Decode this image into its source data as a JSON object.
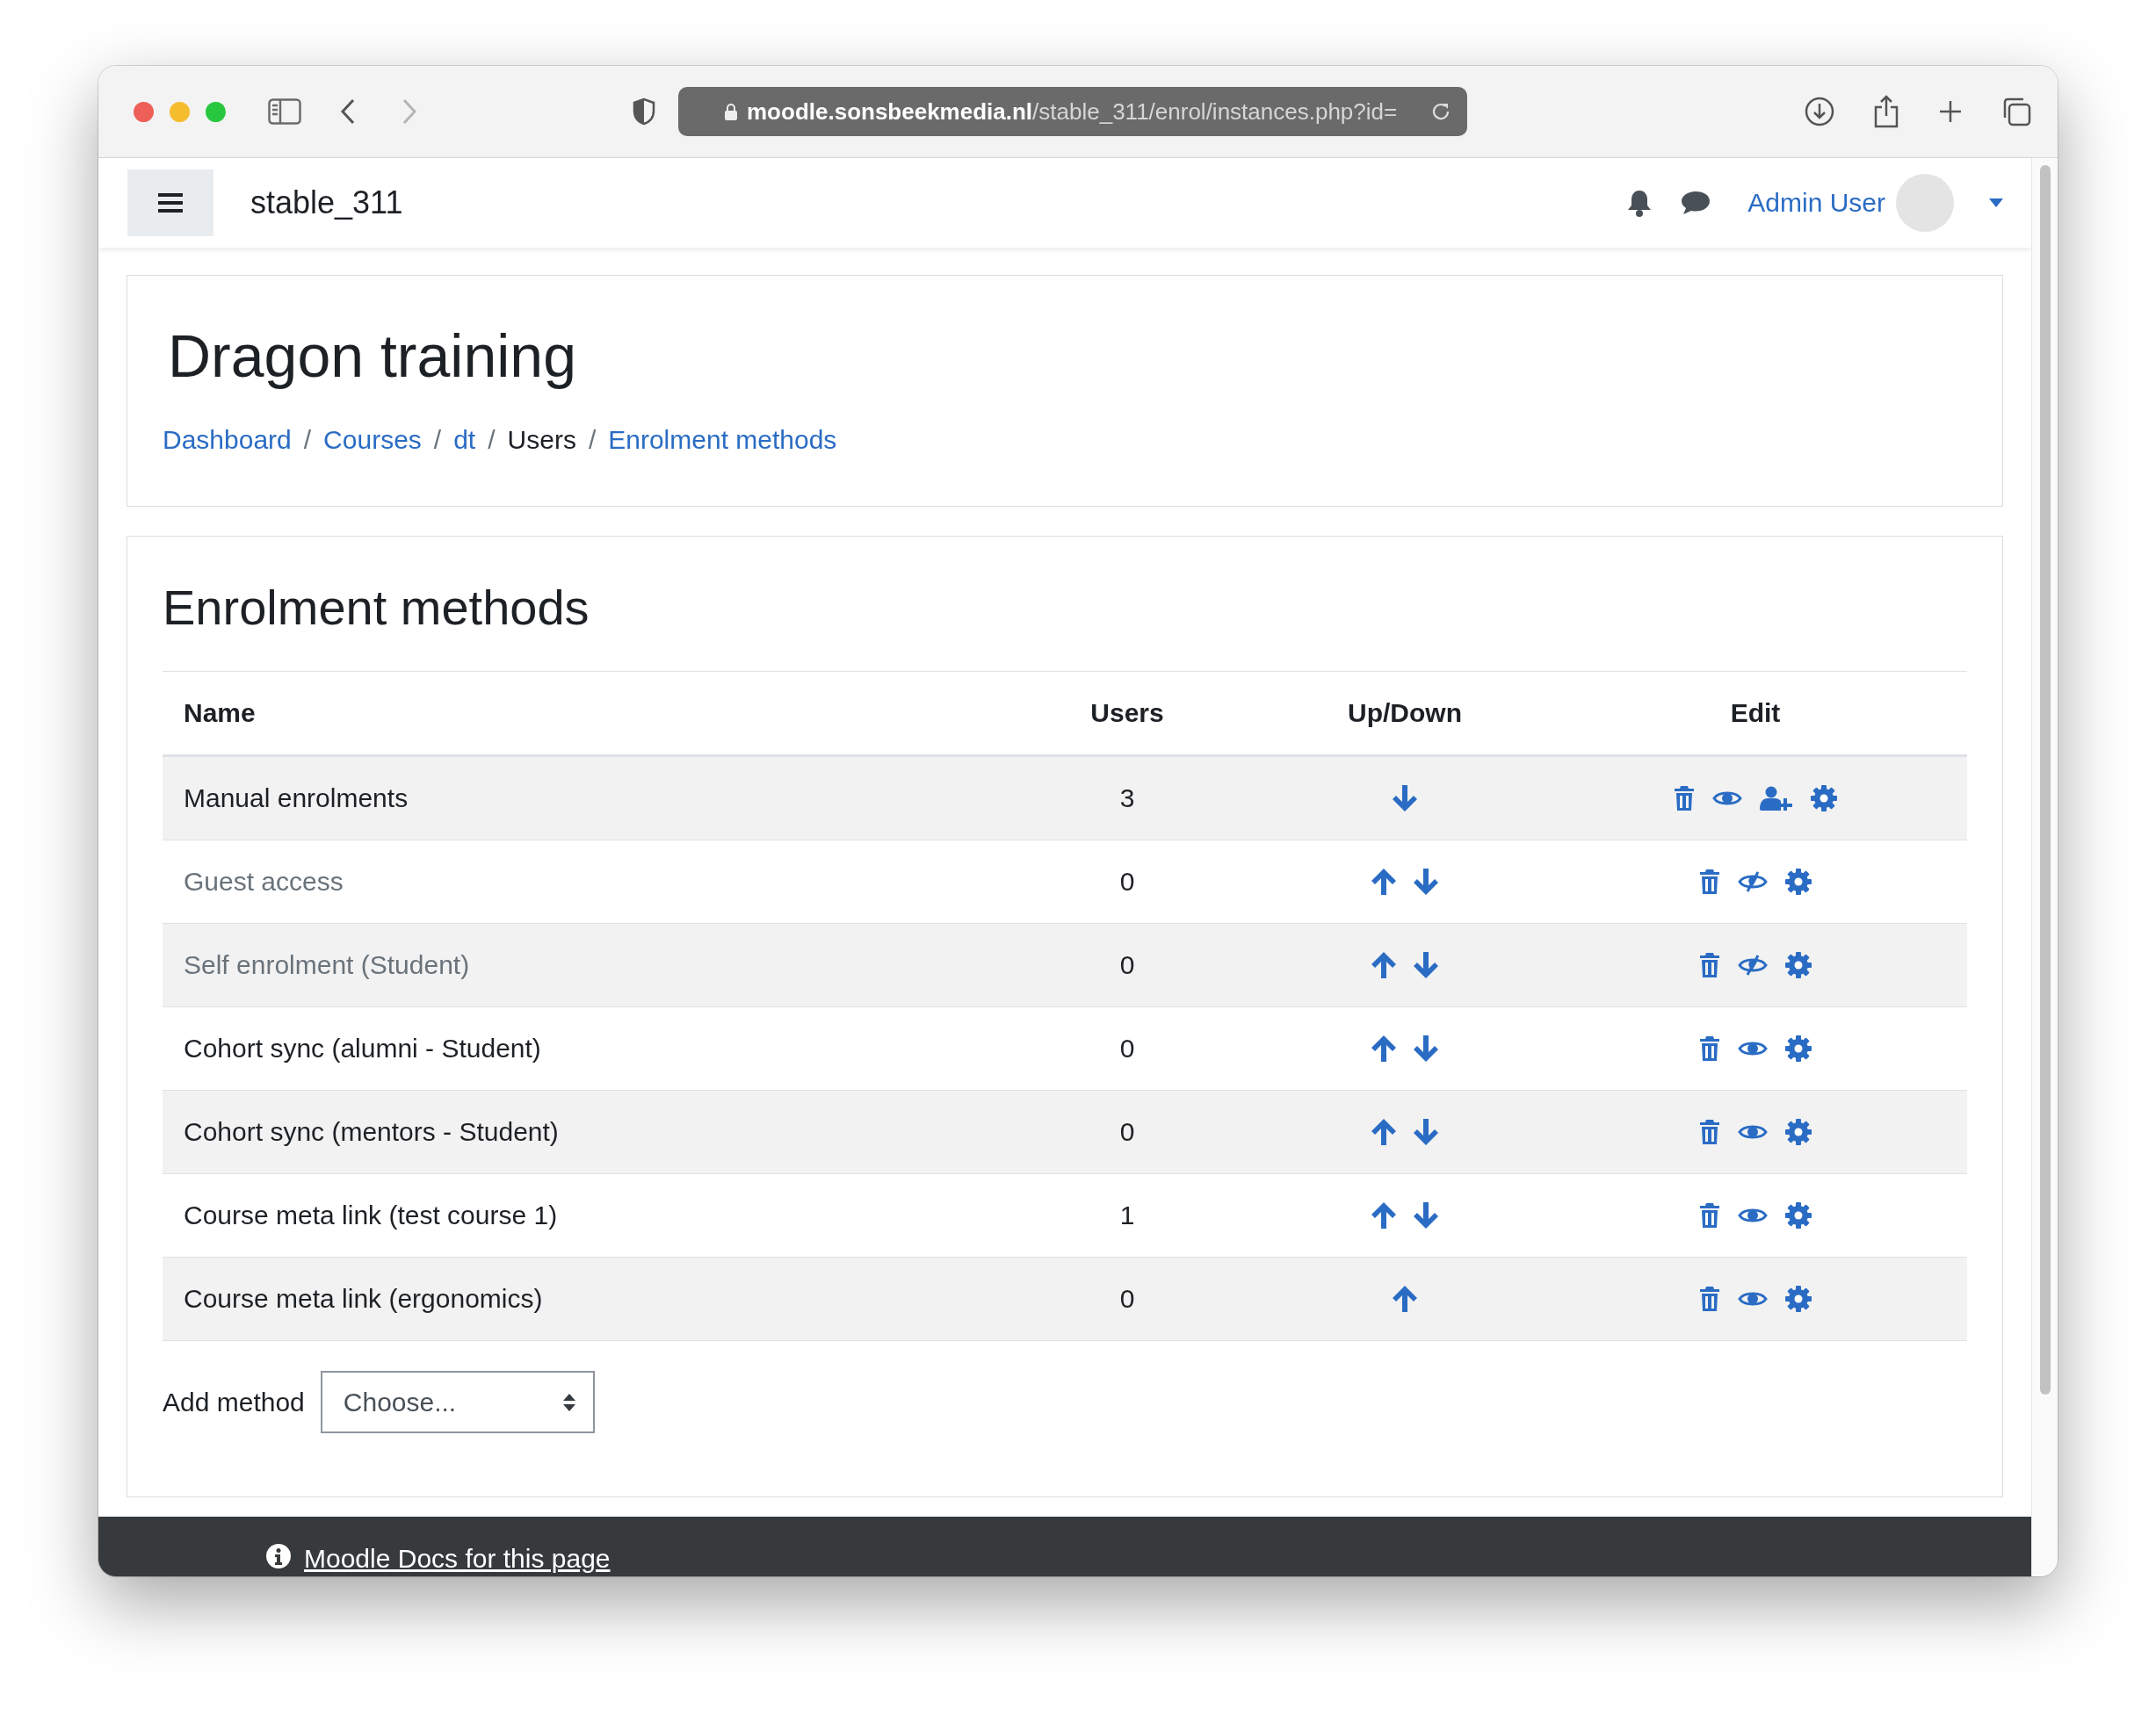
{
  "browser": {
    "url_host": "moodle.sonsbeekmedia.nl",
    "url_path": "/stable_311/enrol/instances.php?id="
  },
  "navbar": {
    "site_name": "stable_311",
    "user_name": "Admin User"
  },
  "page_header": {
    "title": "Dragon training",
    "separator": "/",
    "breadcrumbs": [
      {
        "label": "Dashboard",
        "link": true
      },
      {
        "label": "Courses",
        "link": true
      },
      {
        "label": "dt",
        "link": true
      },
      {
        "label": "Users",
        "link": false
      },
      {
        "label": "Enrolment methods",
        "link": true
      }
    ]
  },
  "section": {
    "heading": "Enrolment methods",
    "table": {
      "columns": [
        "Name",
        "Users",
        "Up/Down",
        "Edit"
      ],
      "rows": [
        {
          "name": "Manual enrolments",
          "users": "3",
          "enabled": true,
          "can_move_up": false,
          "can_move_down": true,
          "can_enrol_users": true
        },
        {
          "name": "Guest access",
          "users": "0",
          "enabled": false,
          "can_move_up": true,
          "can_move_down": true,
          "can_enrol_users": false
        },
        {
          "name": "Self enrolment (Student)",
          "users": "0",
          "enabled": false,
          "can_move_up": true,
          "can_move_down": true,
          "can_enrol_users": false
        },
        {
          "name": "Cohort sync (alumni - Student)",
          "users": "0",
          "enabled": true,
          "can_move_up": true,
          "can_move_down": true,
          "can_enrol_users": false
        },
        {
          "name": "Cohort sync (mentors - Student)",
          "users": "0",
          "enabled": true,
          "can_move_up": true,
          "can_move_down": true,
          "can_enrol_users": false
        },
        {
          "name": "Course meta link (test course 1)",
          "users": "1",
          "enabled": true,
          "can_move_up": true,
          "can_move_down": true,
          "can_enrol_users": false
        },
        {
          "name": "Course meta link (ergonomics)",
          "users": "0",
          "enabled": true,
          "can_move_up": true,
          "can_move_down": false,
          "can_enrol_users": false
        }
      ]
    }
  },
  "add_method": {
    "label": "Add method",
    "value": "Choose..."
  },
  "footer": {
    "link": "Moodle Docs for this page"
  }
}
